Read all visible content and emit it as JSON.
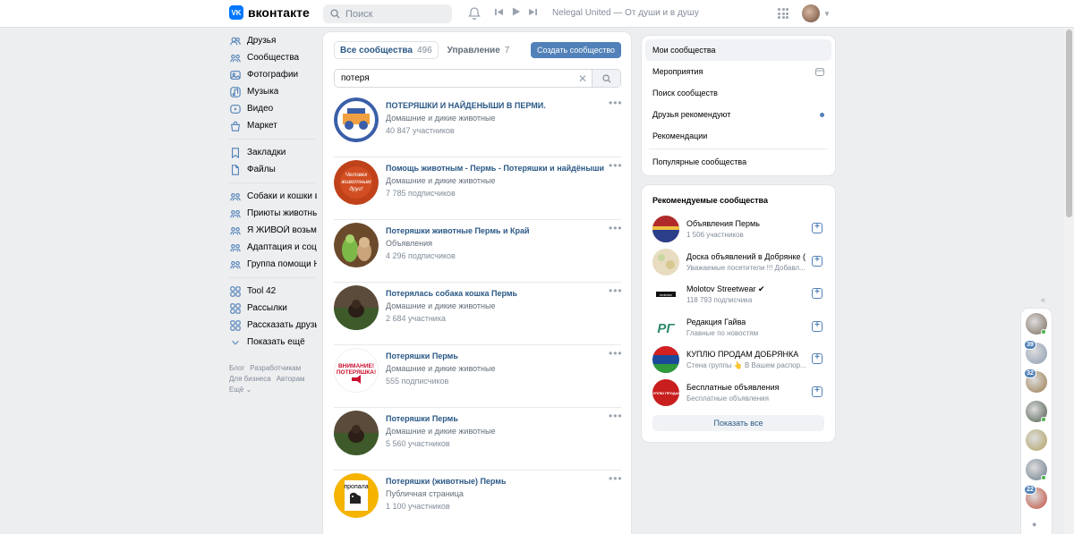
{
  "header": {
    "logo_text": "вконтакте",
    "logo_glyph": "VK",
    "search_placeholder": "Поиск",
    "track": "Nelegal United — От души и в душу (..."
  },
  "sidebar": {
    "items": [
      {
        "label": "Друзья",
        "icon": "friends-icon"
      },
      {
        "label": "Сообщества",
        "icon": "communities-icon"
      },
      {
        "label": "Фотографии",
        "icon": "photos-icon"
      },
      {
        "label": "Музыка",
        "icon": "music-icon"
      },
      {
        "label": "Видео",
        "icon": "video-icon"
      },
      {
        "label": "Маркет",
        "icon": "market-icon"
      }
    ],
    "items2": [
      {
        "label": "Закладки",
        "icon": "bookmark-icon"
      },
      {
        "label": "Файлы",
        "icon": "file-icon"
      }
    ],
    "items3": [
      {
        "label": "Собаки и кошки в ...",
        "icon": "group-icon"
      },
      {
        "label": "Приюты животны...",
        "icon": "group-icon"
      },
      {
        "label": "Я ЖИВОЙ возьми...",
        "icon": "group-icon"
      },
      {
        "label": "Адаптация и соци...",
        "icon": "group-icon"
      },
      {
        "label": "Группа помощи Н...",
        "icon": "group-icon"
      }
    ],
    "items4": [
      {
        "label": "Tool 42",
        "icon": "apps-icon"
      },
      {
        "label": "Рассылки",
        "icon": "apps-icon"
      },
      {
        "label": "Рассказать друзь...",
        "icon": "apps-icon"
      },
      {
        "label": "Показать ещё",
        "icon": "chevron-down-icon"
      }
    ],
    "footer": {
      "blog": "Блог",
      "devs": "Разработчикам",
      "business": "Для бизнеса",
      "authors": "Авторам",
      "more": "Ещё ⌄"
    }
  },
  "main": {
    "tabs": [
      {
        "label": "Все сообщества",
        "count": "496"
      },
      {
        "label": "Управление",
        "count": "7"
      }
    ],
    "create_label": "Создать сообщество",
    "search_value": "потеря",
    "groups": [
      {
        "name": "ПОТЕРЯШКИ И НАЙДЕНЫШИ В ПЕРМИ.",
        "category": "Домашние и дикие животные",
        "subs": "40 847 участников",
        "avatar": "a1"
      },
      {
        "name": "Помощь животным - Пермь - Потеряшки и найдёныши",
        "category": "Домашние и дикие животные",
        "subs": "7 785 подписчиков",
        "avatar": "a2"
      },
      {
        "name": "Потеряшки животные Пермь и Край",
        "category": "Объявления",
        "subs": "4 296 подписчиков",
        "avatar": "a3"
      },
      {
        "name": "Потерялась собака кошка Пермь",
        "category": "Домашние и дикие животные",
        "subs": "2 684 участника",
        "avatar": "a4"
      },
      {
        "name": "Потеряшки Пермь",
        "category": "Домашние и дикие животные",
        "subs": "555 подписчиков",
        "avatar": "a5"
      },
      {
        "name": "Потеряшки Пермь",
        "category": "Домашние и дикие животные",
        "subs": "5 560 участников",
        "avatar": "a6"
      },
      {
        "name": "Потеряшки (животные) Пермь",
        "category": "Публичная страница",
        "subs": "1 100 участников",
        "avatar": "a7"
      }
    ]
  },
  "right_menu": {
    "items": [
      {
        "label": "Мои сообщества"
      },
      {
        "label": "Мероприятия"
      },
      {
        "label": "Поиск сообществ"
      },
      {
        "label": "Друзья рекомендуют"
      },
      {
        "label": "Рекомендации"
      },
      {
        "label": "Популярные сообщества"
      }
    ]
  },
  "recommended": {
    "title": "Рекомендуемые сообщества",
    "items": [
      {
        "name": "Объявления Пермь",
        "sub": "1 506 участников"
      },
      {
        "name": "Доска объявлений в Добрянке ( к...",
        "sub": "Уважаемые посетители !!! Добавл..."
      },
      {
        "name": "Molotov Streetwear ✔",
        "sub": "118 793 подписчика"
      },
      {
        "name": "Редакция Гайва",
        "sub": "Главные по новостям"
      },
      {
        "name": "КУПЛЮ ПРОДАМ ДОБРЯНКА",
        "sub": "Стена группы 👆 В Вашем распор..."
      },
      {
        "name": "Бесплатные объявления",
        "sub": "Бесплатные объявления"
      }
    ],
    "show_all": "Показать все"
  },
  "avatar_texts": {
    "a2_text": "Человек животным друг!",
    "a5_text": "ВНИМАНИЕ! ПОТЕРЯШКА!",
    "a7_text": "пропала",
    "rg_text": "РГ",
    "molotov_text": "molotov",
    "kupi_text": "КУПЛЮ ПРОДАМ"
  },
  "fast_chat": {
    "badges": [
      "39",
      "32",
      "22"
    ]
  },
  "colors": {
    "accent": "#5181b8",
    "link": "#2a5885",
    "bg": "#edeef0",
    "brand": "#0077ff"
  }
}
